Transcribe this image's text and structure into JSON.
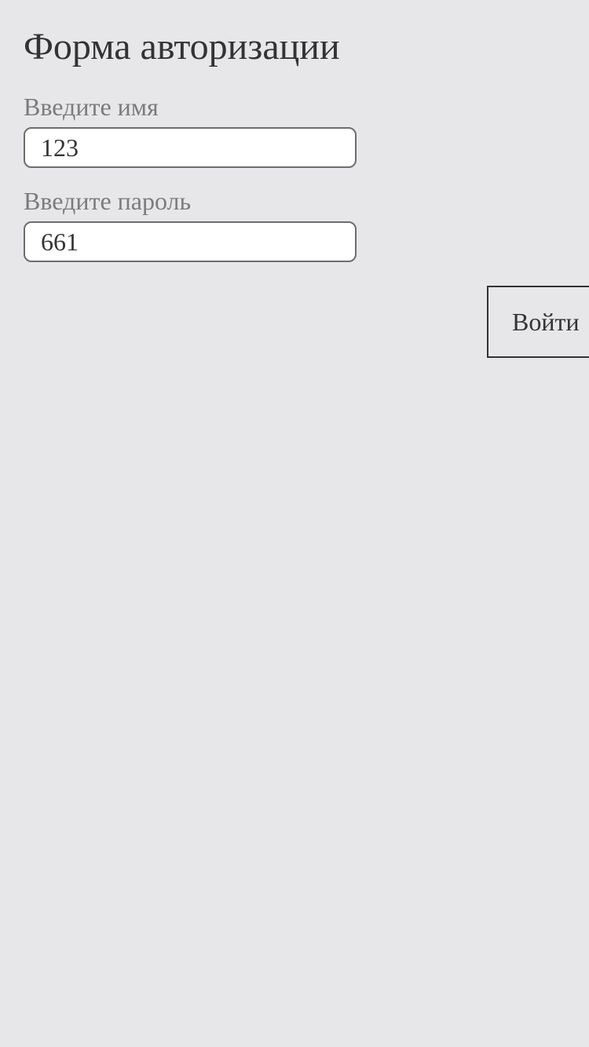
{
  "form": {
    "title": "Форма авторизации",
    "name_label": "Введите имя",
    "name_value": "123",
    "password_label": "Введите пароль",
    "password_value": "661",
    "submit_label": "Войти"
  }
}
